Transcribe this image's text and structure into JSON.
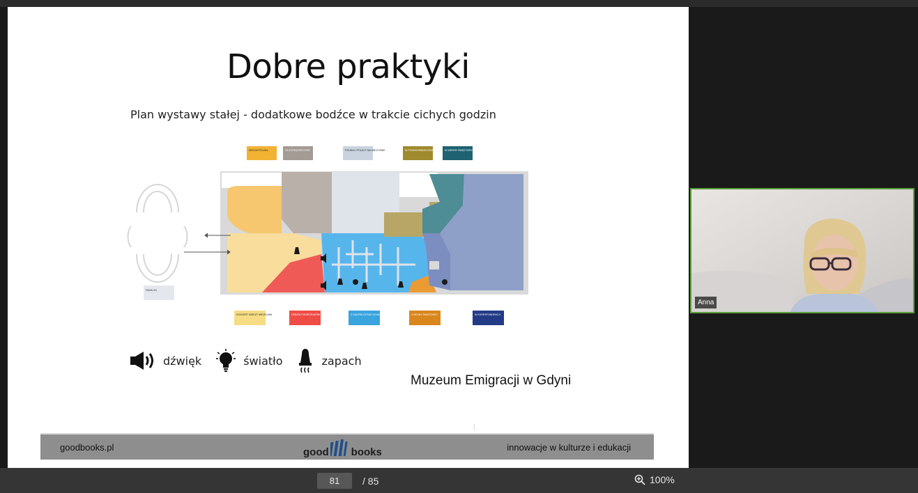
{
  "slide": {
    "title": "Dobre praktyki",
    "subtitle": "Plan wystawy stałej - dodatkowe bodźce w trakcie cichych godzin",
    "plan": {
      "top_labels": [
        "WOLNA POLSKA",
        "ZA ZGODĄ REKTORA",
        "POLSKA I POLACY NA OBCZYŹNIE",
        "W POSZUKIWANIU DOMU",
        "W WIERZE ŚWIĘTOKRZYSKIEJ"
      ],
      "bottom_labels": [
        "KONCERT MIEDZY MIEJSCAMI",
        "DEBATA PODRÓŻNIKÓW",
        "Z GALERII SZTUKI DO MIASTA",
        "Z WOJNY ŚWIATOWEJ",
        "W KORESPONDENCJI"
      ],
      "side_label": "PAWILON",
      "label_colors": [
        "#f2b234",
        "#a59b95",
        "#c9d3df",
        "#a08a2e",
        "#1f6272",
        "#f6dd84",
        "#ee4d45",
        "#3aa4de",
        "#d9861d",
        "#233b86"
      ]
    },
    "legend": [
      {
        "icon": "speaker-icon",
        "label": "dźwięk"
      },
      {
        "icon": "lightbulb-icon",
        "label": "światło"
      },
      {
        "icon": "scent-icon",
        "label": "zapach"
      }
    ],
    "credit": "Muzeum Emigracji w Gdyni",
    "footer": {
      "left": "goodbooks.pl",
      "logo_left": "good",
      "logo_right": "books",
      "right": "innowacje w kulturze i edukacji"
    }
  },
  "participant": {
    "name": "Anna",
    "active_speaker_color": "#5a9e3a"
  },
  "viewer": {
    "current_page": "81",
    "total_pages": "/ 85",
    "zoom": "100%"
  }
}
